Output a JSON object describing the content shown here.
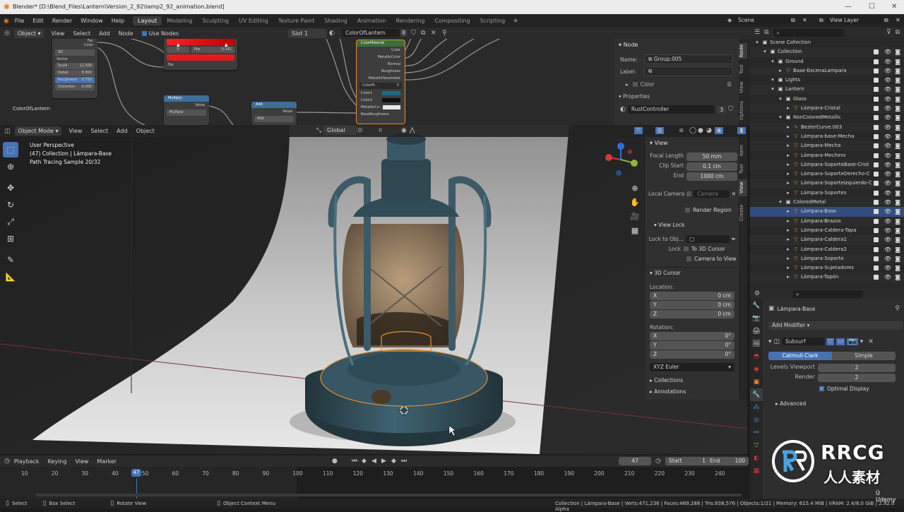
{
  "window": {
    "title": "Blender* [D:\\Blend_Files\\Lantern\\Version_2_92\\lamp2_92_animation.blend]",
    "controls": [
      "—",
      "☐",
      "✕"
    ]
  },
  "menubar": {
    "menus": [
      "File",
      "Edit",
      "Render",
      "Window",
      "Help"
    ],
    "workspaces": [
      "Layout",
      "Modeling",
      "Sculpting",
      "UV Editing",
      "Texture Paint",
      "Shading",
      "Animation",
      "Rendering",
      "Compositing",
      "Scripting"
    ],
    "active_workspace": "Layout",
    "scene": "Scene",
    "view_layer": "View Layer"
  },
  "node_header": {
    "mode": "Object",
    "menus": [
      "View",
      "Select",
      "Add",
      "Node"
    ],
    "use_nodes_label": "Use Nodes",
    "slot": "Slot 1",
    "material": "ColorOfLantern",
    "material_users": "8"
  },
  "nodes": {
    "noise": {
      "rows": [
        "Fac",
        "Color"
      ],
      "dropdown": "3D",
      "vector": "Vector",
      "scale_label": "Scale",
      "scale_value": "11.500",
      "detail_label": "Detail",
      "detail_value": "8.800",
      "roughness_label": "Roughness",
      "roughness_value": "0.750",
      "distortion_label": "Distortion",
      "distortion_value": "0.000"
    },
    "ramp": {
      "pos": "0",
      "pos_label": "Pos",
      "pos_value": "0.141",
      "fac": "Fac"
    },
    "multiply": {
      "title": "Multiply",
      "out": "Value",
      "mode": "Multiply"
    },
    "add": {
      "title": "Add",
      "out": "Value",
      "mode": "Add"
    },
    "group": {
      "title": "ColorMaterial",
      "outs": [
        "Color",
        "MetallicColor",
        "Normal",
        "Roughness",
        "MetallicParameter"
      ],
      "ins": [
        "Color1",
        "Color2",
        "MetallicCo...",
        "BaseRoughness"
      ],
      "name": "ColorM...",
      "users": "5"
    },
    "frame_label": "ColorOfLantern"
  },
  "node_props": {
    "section": "Node",
    "name_label": "Name:",
    "name_value": "Group.005",
    "label_label": "Label:",
    "color_label": "Color",
    "properties_label": "Properties",
    "group_name": "RustController",
    "group_users": "3",
    "tabs": [
      "Node",
      "Tool",
      "View",
      "Options"
    ]
  },
  "viewport_header": {
    "mode": "Object Mode",
    "menus": [
      "View",
      "Select",
      "Add",
      "Object"
    ],
    "orientation": "Global"
  },
  "viewport_overlay": {
    "line1": "User Perspective",
    "line2": "(47) Collection | Lámpara-Base",
    "line3": "Path Tracing Sample 20/32"
  },
  "npanel": {
    "view_section": "View",
    "focal_label": "Focal Length",
    "focal_value": "50 mm",
    "clip_start_label": "Clip Start",
    "clip_start_value": "0.1 cm",
    "end_label": "End",
    "end_value": "1000 cm",
    "local_camera_label": "Local Camera",
    "camera_placeholder": "Camera",
    "render_region_label": "Render Region",
    "view_lock_section": "View Lock",
    "lock_to_obj_label": "Lock to Obj...",
    "lock_label": "Lock",
    "to_3d_cursor": "To 3D Cursor",
    "camera_to_view": "Camera to View",
    "cursor_section": "3D Cursor",
    "location_label": "Location:",
    "loc": [
      {
        "axis": "X",
        "value": "0 cm"
      },
      {
        "axis": "Y",
        "value": "0 cm"
      },
      {
        "axis": "Z",
        "value": "0 cm"
      }
    ],
    "rotation_label": "Rotation:",
    "rot": [
      {
        "axis": "X",
        "value": "0°"
      },
      {
        "axis": "Y",
        "value": "0°"
      },
      {
        "axis": "Z",
        "value": "0°"
      }
    ],
    "rotation_mode": "XYZ Euler",
    "collections": "Collections",
    "annotations": "Annotations",
    "tabs": [
      "Item",
      "Tool",
      "View",
      "Create"
    ]
  },
  "outliner": {
    "rows": [
      {
        "label": "Scene Collection",
        "indent": 0,
        "icon": "▣"
      },
      {
        "label": "Collection",
        "indent": 1,
        "icon": "▣"
      },
      {
        "label": "Ground",
        "indent": 2,
        "icon": "▣"
      },
      {
        "label": "Base-EscenaLampara",
        "indent": 3,
        "icon": "▽"
      },
      {
        "label": "Lights",
        "indent": 2,
        "icon": "▣"
      },
      {
        "label": "Lantern",
        "indent": 2,
        "icon": "▣"
      },
      {
        "label": "Glass",
        "indent": 3,
        "icon": "▣"
      },
      {
        "label": "Lámpara-Cristal",
        "indent": 4,
        "icon": "▽"
      },
      {
        "label": "NonColoredMetallic",
        "indent": 3,
        "icon": "▣"
      },
      {
        "label": "BezierCurve.003",
        "indent": 4,
        "icon": "∿"
      },
      {
        "label": "Lámpara-base-Mecha",
        "indent": 4,
        "icon": "▽"
      },
      {
        "label": "Lámpara-Mecha",
        "indent": 4,
        "icon": "▽"
      },
      {
        "label": "Lámpara-Mechero",
        "indent": 4,
        "icon": "▽"
      },
      {
        "label": "Lámpara-SoporteBase-Crist",
        "indent": 4,
        "icon": "▽"
      },
      {
        "label": "Lámpara-SoporteDerecho-C",
        "indent": 4,
        "icon": "▽"
      },
      {
        "label": "Lámpara-SoporteIzquierdo-C",
        "indent": 4,
        "icon": "▽"
      },
      {
        "label": "Lámpara-Soportes",
        "indent": 4,
        "icon": "▽"
      },
      {
        "label": "ColoredMetal",
        "indent": 3,
        "icon": "▣"
      },
      {
        "label": "Lámpara-Base",
        "indent": 4,
        "icon": "▽",
        "selected": true
      },
      {
        "label": "Lámpara-Brazos",
        "indent": 4,
        "icon": "▽"
      },
      {
        "label": "Lámpara-Caldera-Tapa",
        "indent": 4,
        "icon": "▽"
      },
      {
        "label": "Lámpara-Caldera1",
        "indent": 4,
        "icon": "▽"
      },
      {
        "label": "Lámpara-Caldera2",
        "indent": 4,
        "icon": "▽"
      },
      {
        "label": "Lámpara-Soporte",
        "indent": 4,
        "icon": "▽"
      },
      {
        "label": "Lámpara-Sujetadores",
        "indent": 4,
        "icon": "▽"
      },
      {
        "label": "Lámpara-Tapón",
        "indent": 4,
        "icon": "▽"
      }
    ]
  },
  "properties": {
    "object_name": "Lámpara-Base",
    "add_modifier": "Add Modifier",
    "modifier_name": "Subsurf",
    "catmull": "Catmull-Clark",
    "simple": "Simple",
    "levels_label": "Levels Viewport",
    "levels_value": "2",
    "render_label": "Render",
    "render_value": "2",
    "optimal_display": "Optimal Display",
    "advanced": "Advanced"
  },
  "timeline": {
    "menus": [
      "Playback",
      "Keying",
      "View",
      "Marker"
    ],
    "current_frame": "47",
    "start_label": "Start",
    "start_value": "1",
    "end_label": "End",
    "end_value": "100",
    "ticks": [
      "10",
      "20",
      "30",
      "40",
      "50",
      "60",
      "70",
      "80",
      "90",
      "100",
      "110",
      "120",
      "130",
      "140",
      "150",
      "160",
      "170",
      "180",
      "190",
      "200",
      "210",
      "220",
      "230",
      "240"
    ]
  },
  "statusbar": {
    "select": "Select",
    "box_select": "Box Select",
    "rotate_view": "Rotate View",
    "context_menu": "Object Context Menu",
    "stats": "Collection | Lámpara-Base | Verts:471,236 | Faces:469,288 | Tris:938,576 | Objects:1/21 | Memory: 615.4 MiB | VRAM: 2.4/8.0 GiB | 2.92.0 Alpha"
  },
  "watermark": {
    "brand": "RRCG",
    "sub": "人人素材",
    "udemy": "Udemy"
  },
  "colors": {
    "accent": "#4772b3",
    "selection": "#334d80",
    "lantern_body": "#3d5a66",
    "highlight": "#e8902a"
  }
}
